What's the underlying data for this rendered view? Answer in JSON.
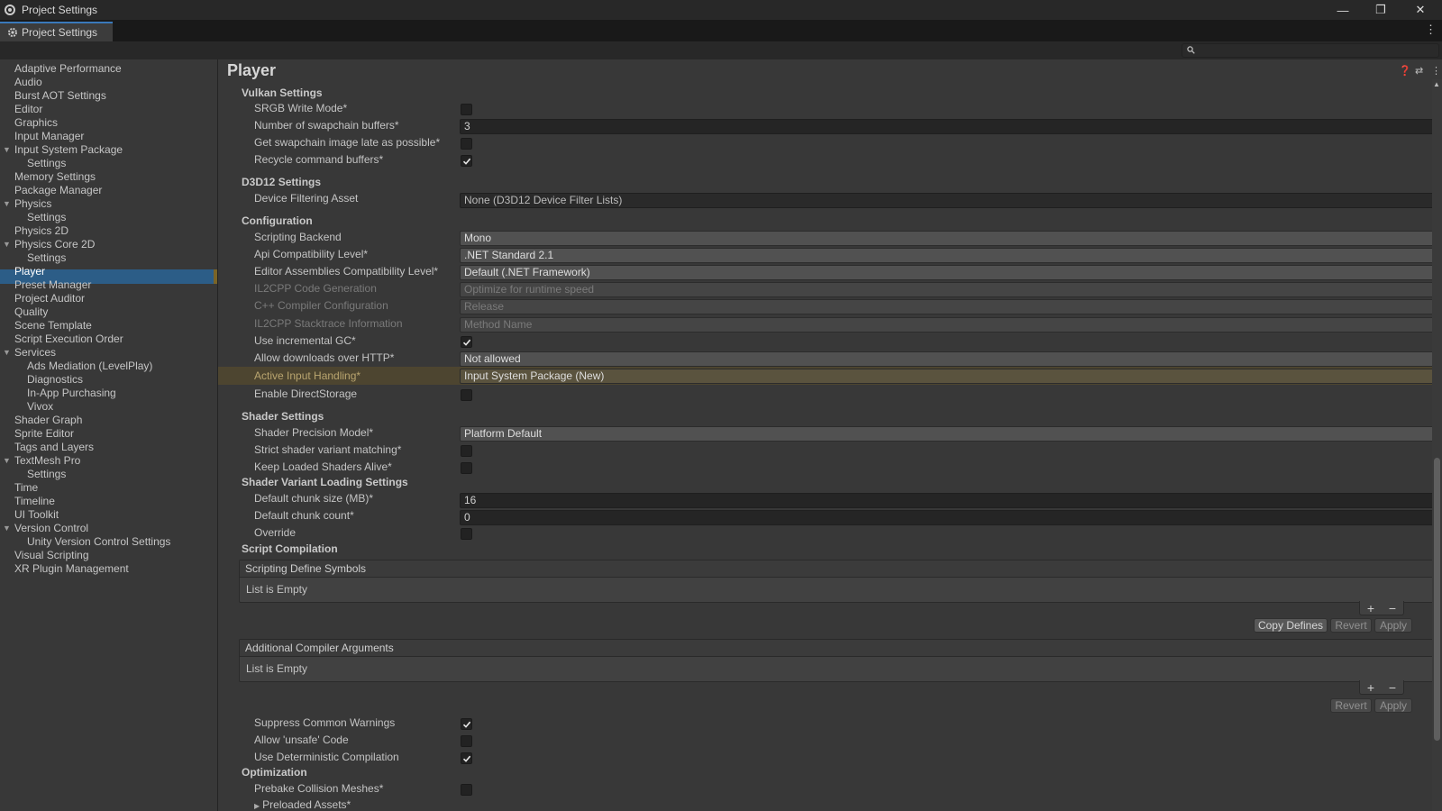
{
  "window": {
    "title": "Project Settings"
  },
  "tab": {
    "label": "Project Settings"
  },
  "search": {
    "placeholder": ""
  },
  "sidebar": {
    "items": [
      {
        "label": "Adaptive Performance",
        "indent": 0,
        "expanded": false,
        "has_arrow": false
      },
      {
        "label": "Audio",
        "indent": 0,
        "has_arrow": false
      },
      {
        "label": "Burst AOT Settings",
        "indent": 0,
        "has_arrow": false
      },
      {
        "label": "Editor",
        "indent": 0,
        "has_arrow": false
      },
      {
        "label": "Graphics",
        "indent": 0,
        "has_arrow": false
      },
      {
        "label": "Input Manager",
        "indent": 0,
        "has_arrow": false
      },
      {
        "label": "Input System Package",
        "indent": 0,
        "has_arrow": true
      },
      {
        "label": "Settings",
        "indent": 1,
        "has_arrow": false
      },
      {
        "label": "Memory Settings",
        "indent": 0,
        "has_arrow": false
      },
      {
        "label": "Package Manager",
        "indent": 0,
        "has_arrow": false
      },
      {
        "label": "Physics",
        "indent": 0,
        "has_arrow": true
      },
      {
        "label": "Settings",
        "indent": 1,
        "has_arrow": false
      },
      {
        "label": "Physics 2D",
        "indent": 0,
        "has_arrow": false
      },
      {
        "label": "Physics Core 2D",
        "indent": 0,
        "has_arrow": true
      },
      {
        "label": "Settings",
        "indent": 1,
        "has_arrow": false
      },
      {
        "label": "Player",
        "indent": 0,
        "has_arrow": false,
        "selected": true
      },
      {
        "label": "Preset Manager",
        "indent": 0,
        "has_arrow": false
      },
      {
        "label": "Project Auditor",
        "indent": 0,
        "has_arrow": false
      },
      {
        "label": "Quality",
        "indent": 0,
        "has_arrow": false
      },
      {
        "label": "Scene Template",
        "indent": 0,
        "has_arrow": false
      },
      {
        "label": "Script Execution Order",
        "indent": 0,
        "has_arrow": false
      },
      {
        "label": "Services",
        "indent": 0,
        "has_arrow": true
      },
      {
        "label": "Ads Mediation (LevelPlay)",
        "indent": 1,
        "has_arrow": false
      },
      {
        "label": "Diagnostics",
        "indent": 1,
        "has_arrow": false
      },
      {
        "label": "In-App Purchasing",
        "indent": 1,
        "has_arrow": false
      },
      {
        "label": "Vivox",
        "indent": 1,
        "has_arrow": false
      },
      {
        "label": "Shader Graph",
        "indent": 0,
        "has_arrow": false
      },
      {
        "label": "Sprite Editor",
        "indent": 0,
        "has_arrow": false
      },
      {
        "label": "Tags and Layers",
        "indent": 0,
        "has_arrow": false
      },
      {
        "label": "TextMesh Pro",
        "indent": 0,
        "has_arrow": true
      },
      {
        "label": "Settings",
        "indent": 1,
        "has_arrow": false
      },
      {
        "label": "Time",
        "indent": 0,
        "has_arrow": false
      },
      {
        "label": "Timeline",
        "indent": 0,
        "has_arrow": false
      },
      {
        "label": "UI Toolkit",
        "indent": 0,
        "has_arrow": false
      },
      {
        "label": "Version Control",
        "indent": 0,
        "has_arrow": true
      },
      {
        "label": "Unity Version Control Settings",
        "indent": 1,
        "has_arrow": false
      },
      {
        "label": "Visual Scripting",
        "indent": 0,
        "has_arrow": false
      },
      {
        "label": "XR Plugin Management",
        "indent": 0,
        "has_arrow": false
      }
    ]
  },
  "main": {
    "title": "Player",
    "vulkan": {
      "header": "Vulkan Settings",
      "srgb": {
        "label": "SRGB Write Mode*",
        "checked": false
      },
      "swapchain": {
        "label": "Number of swapchain buffers*",
        "value": "3"
      },
      "late": {
        "label": "Get swapchain image late as possible*",
        "checked": false
      },
      "recycle": {
        "label": "Recycle command buffers*",
        "checked": true
      }
    },
    "d3d12": {
      "header": "D3D12 Settings",
      "filter": {
        "label": "Device Filtering Asset",
        "value": "None (D3D12 Device Filter Lists)"
      }
    },
    "config": {
      "header": "Configuration",
      "backend": {
        "label": "Scripting Backend",
        "value": "Mono"
      },
      "api": {
        "label": "Api Compatibility Level*",
        "value": ".NET Standard 2.1"
      },
      "editor_asm": {
        "label": "Editor Assemblies Compatibility Level*",
        "value": "Default (.NET Framework)"
      },
      "il2cpp_gen": {
        "label": "IL2CPP Code Generation",
        "value": "Optimize for runtime speed"
      },
      "cpp_cfg": {
        "label": "C++ Compiler Configuration",
        "value": "Release"
      },
      "stacktrace": {
        "label": "IL2CPP Stacktrace Information",
        "value": "Method Name"
      },
      "incgc": {
        "label": "Use incremental GC*",
        "checked": true
      },
      "downloads": {
        "label": "Allow downloads over HTTP*",
        "value": "Not allowed"
      },
      "input": {
        "label": "Active Input Handling*",
        "value": "Input System Package (New)"
      },
      "directstorage": {
        "label": "Enable DirectStorage",
        "checked": false
      }
    },
    "shader": {
      "header": "Shader Settings",
      "precision": {
        "label": "Shader Precision Model*",
        "value": "Platform Default"
      },
      "strict": {
        "label": "Strict shader variant matching*",
        "checked": false
      },
      "keep": {
        "label": "Keep Loaded Shaders Alive*",
        "checked": false
      }
    },
    "variant": {
      "header": "Shader Variant Loading Settings",
      "chunk_size": {
        "label": "Default chunk size (MB)*",
        "value": "16"
      },
      "chunk_count": {
        "label": "Default chunk count*",
        "value": "0"
      },
      "override": {
        "label": "Override",
        "checked": false
      }
    },
    "compilation": {
      "header": "Script Compilation",
      "defines": {
        "header": "Scripting Define Symbols",
        "empty": "List is Empty"
      },
      "args": {
        "header": "Additional Compiler Arguments",
        "empty": "List is Empty"
      },
      "plus": "+",
      "minus": "−",
      "copy_defines": "Copy Defines",
      "revert": "Revert",
      "apply": "Apply",
      "suppress": {
        "label": "Suppress Common Warnings",
        "checked": true
      },
      "unsafe": {
        "label": "Allow 'unsafe' Code",
        "checked": false
      },
      "deterministic": {
        "label": "Use Deterministic Compilation",
        "checked": true
      }
    },
    "optimization": {
      "header": "Optimization",
      "prebake": {
        "label": "Prebake Collision Meshes*",
        "checked": false
      },
      "preloaded": {
        "label": "Preloaded Assets*"
      }
    }
  },
  "colors": {
    "accent": "#2c5d87",
    "highlight": "#4d4530",
    "selection_marker": "#7a6427"
  }
}
